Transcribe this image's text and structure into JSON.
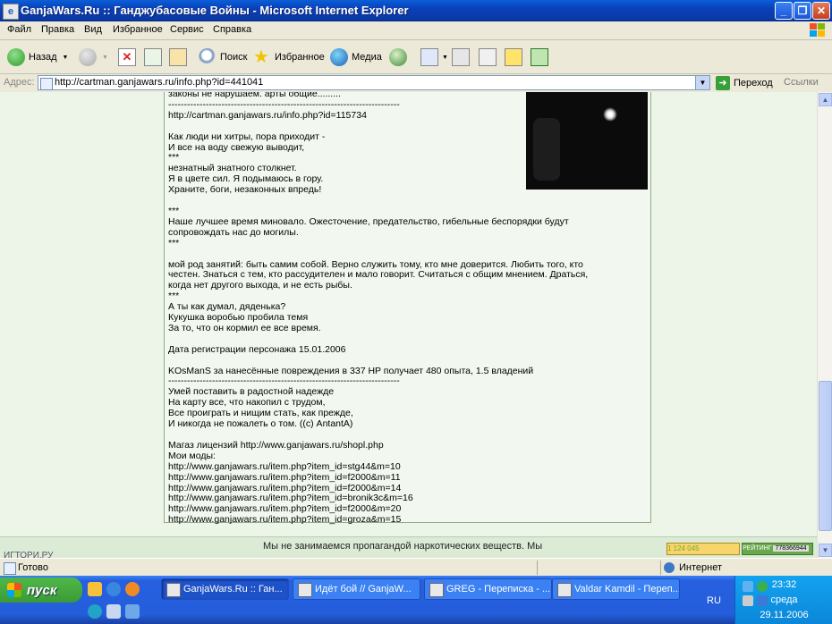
{
  "window": {
    "title": "GanjaWars.Ru :: Ганджубасовые Войны - Microsoft Internet Explorer",
    "icon_letter": "e",
    "minimize": "_",
    "maximize": "❐",
    "close": "✕"
  },
  "menu": [
    "Файл",
    "Правка",
    "Вид",
    "Избранное",
    "Сервис",
    "Справка"
  ],
  "toolbar": {
    "back": "Назад",
    "search": "Поиск",
    "favorites": "Избранное",
    "media": "Медиа"
  },
  "address": {
    "label": "Адрес:",
    "url": "http://cartman.ganjawars.ru/info.php?id=441041",
    "go": "Переход",
    "links": "Ссылки"
  },
  "profile": {
    "text_lines": [
      "законы не нарушаем. арты общие.........",
      "--------------------------------------------------------------------------",
      "http://cartman.ganjawars.ru/info.php?id=115734",
      "",
      "Как люди ни хитры, пора приходит -",
      "И все на воду свежую выводит,",
      "***",
      "незнатный знатного столкнет.",
      "Я в цвете сил. Я подымаюсь в гору.",
      "Храните, боги, незаконных впредь!",
      "",
      "***",
      "Наше лучшее время миновало. Ожесточение, предательство, гибельные беспорядки будут",
      "сопровождать нас до могилы.",
      "***",
      "",
      "мой род занятий: быть самим собой. Верно служить тому, кто мне доверится. Любить того, кто",
      "честен. Знаться с тем, кто рассудителен и мало говорит. Считаться с общим мнением. Драться,",
      "когда нет другого выхода, и не есть рыбы.",
      "***",
      "А ты как думал, дяденька?",
      "Кукушка воробью пробила темя",
      "За то, что он кормил ее все время.",
      "",
      "Дата регистрации персонажа 15.01.2006",
      "",
      "KOsManS за нанесённые повреждения в 337 HP получает 480 опыта, 1.5 владений",
      "--------------------------------------------------------------------------",
      "Умей поставить в радостной надежде",
      "На карту все, что накопил с трудом,",
      "Все проиграть и нищим стать, как прежде,",
      "И никогда не пожалеть о том. ((c) AntantA)",
      "",
      "Магаз лицензий http://www.ganjawars.ru/shopl.php",
      "Мои моды:",
      "http://www.ganjawars.ru/item.php?item_id=stg44&m=10",
      "http://www.ganjawars.ru/item.php?item_id=f2000&m=11",
      "http://www.ganjawars.ru/item.php?item_id=f2000&m=14",
      "http://www.ganjawars.ru/item.php?item_id=bronik3c&m=16",
      "http://www.ganjawars.ru/item.php?item_id=f2000&m=20",
      "http://www.ganjawars.ru/item.php?item_id=groza&m=15"
    ]
  },
  "footer": {
    "disclaimer": "Мы не занимаемся пропагандой наркотических веществ. Мы",
    "left_cut": "ИГТОРИ.РУ",
    "counter": "1 124 045",
    "rating_label": "РЕЙТИНГ",
    "rating_value": "778366944"
  },
  "status": {
    "text": "Готово",
    "zone": "Интернет"
  },
  "taskbar": {
    "start": "пуск",
    "tasks": [
      "GanjaWars.Ru :: Ган...",
      "Идёт бой // GanjaW...",
      "GREG - Переписка - ...",
      "Valdar Kamdil - Переп..."
    ],
    "lang": "RU",
    "time": "23:32",
    "day": "среда",
    "date": "29.11.2006"
  },
  "colors": {
    "titlebar": "#0b3aa8",
    "page_bg": "#edf5e9",
    "panel_border": "#8fab85",
    "taskbar": "#245edb",
    "start": "#3a9a35"
  }
}
